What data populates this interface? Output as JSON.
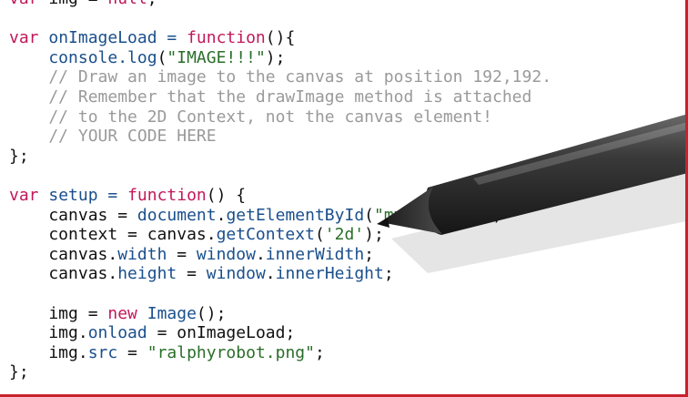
{
  "code_lines": [
    [
      {
        "t": "var",
        "c": "kw"
      },
      {
        "t": " img = ",
        "c": "plain"
      },
      {
        "t": "null",
        "c": "kw"
      },
      {
        "t": ";",
        "c": "plain"
      }
    ],
    [],
    [
      {
        "t": "var",
        "c": "kw"
      },
      {
        "t": " onImageLoad = ",
        "c": "fn"
      },
      {
        "t": "function",
        "c": "kw"
      },
      {
        "t": "(){",
        "c": "plain"
      }
    ],
    [
      {
        "t": "    console.",
        "c": "fn"
      },
      {
        "t": "log",
        "c": "fn"
      },
      {
        "t": "(",
        "c": "plain"
      },
      {
        "t": "\"IMAGE!!!\"",
        "c": "str"
      },
      {
        "t": ");",
        "c": "plain"
      }
    ],
    [
      {
        "t": "    // Draw an image to the canvas at position 192,192.",
        "c": "cm"
      }
    ],
    [
      {
        "t": "    // Remember that the drawImage method is attached",
        "c": "cm"
      }
    ],
    [
      {
        "t": "    // to the 2D Context, not the canvas element!",
        "c": "cm"
      }
    ],
    [
      {
        "t": "    // YOUR CODE HERE",
        "c": "cm"
      }
    ],
    [
      {
        "t": "};",
        "c": "plain"
      }
    ],
    [],
    [
      {
        "t": "var",
        "c": "kw"
      },
      {
        "t": " setup = ",
        "c": "fn"
      },
      {
        "t": "function",
        "c": "kw"
      },
      {
        "t": "() {",
        "c": "plain"
      }
    ],
    [
      {
        "t": "    canvas = ",
        "c": "plain"
      },
      {
        "t": "document",
        "c": "fn"
      },
      {
        "t": ".",
        "c": "plain"
      },
      {
        "t": "getElementById",
        "c": "fn"
      },
      {
        "t": "(",
        "c": "plain"
      },
      {
        "t": "\"my_canvas\"",
        "c": "str"
      },
      {
        "t": ");",
        "c": "plain"
      }
    ],
    [
      {
        "t": "    context = canvas.",
        "c": "plain"
      },
      {
        "t": "getContext",
        "c": "fn"
      },
      {
        "t": "(",
        "c": "plain"
      },
      {
        "t": "'2d'",
        "c": "str"
      },
      {
        "t": ");",
        "c": "plain"
      }
    ],
    [
      {
        "t": "    canvas.",
        "c": "plain"
      },
      {
        "t": "width",
        "c": "fn"
      },
      {
        "t": " = ",
        "c": "plain"
      },
      {
        "t": "window",
        "c": "fn"
      },
      {
        "t": ".",
        "c": "plain"
      },
      {
        "t": "innerWidth",
        "c": "fn"
      },
      {
        "t": ";",
        "c": "plain"
      }
    ],
    [
      {
        "t": "    canvas.",
        "c": "plain"
      },
      {
        "t": "height",
        "c": "fn"
      },
      {
        "t": " = ",
        "c": "plain"
      },
      {
        "t": "window",
        "c": "fn"
      },
      {
        "t": ".",
        "c": "plain"
      },
      {
        "t": "innerHeight",
        "c": "fn"
      },
      {
        "t": ";",
        "c": "plain"
      }
    ],
    [],
    [
      {
        "t": "    img = ",
        "c": "plain"
      },
      {
        "t": "new",
        "c": "kw"
      },
      {
        "t": " ",
        "c": "plain"
      },
      {
        "t": "Image",
        "c": "fn"
      },
      {
        "t": "();",
        "c": "plain"
      }
    ],
    [
      {
        "t": "    img.",
        "c": "plain"
      },
      {
        "t": "onload",
        "c": "fn"
      },
      {
        "t": " = onImageLoad;",
        "c": "plain"
      }
    ],
    [
      {
        "t": "    img.",
        "c": "plain"
      },
      {
        "t": "src",
        "c": "fn"
      },
      {
        "t": " = ",
        "c": "plain"
      },
      {
        "t": "\"ralphyrobot.png\"",
        "c": "str"
      },
      {
        "t": ";",
        "c": "plain"
      }
    ],
    [
      {
        "t": "};",
        "c": "plain"
      }
    ]
  ],
  "colors": {
    "keyword": "#c2185b",
    "identifier": "#1a4f8c",
    "string": "#2a6e2a",
    "comment": "#9a9a9a",
    "frame_border": "#c8232c"
  },
  "overlay": {
    "icon": "stylus-pen-icon"
  }
}
